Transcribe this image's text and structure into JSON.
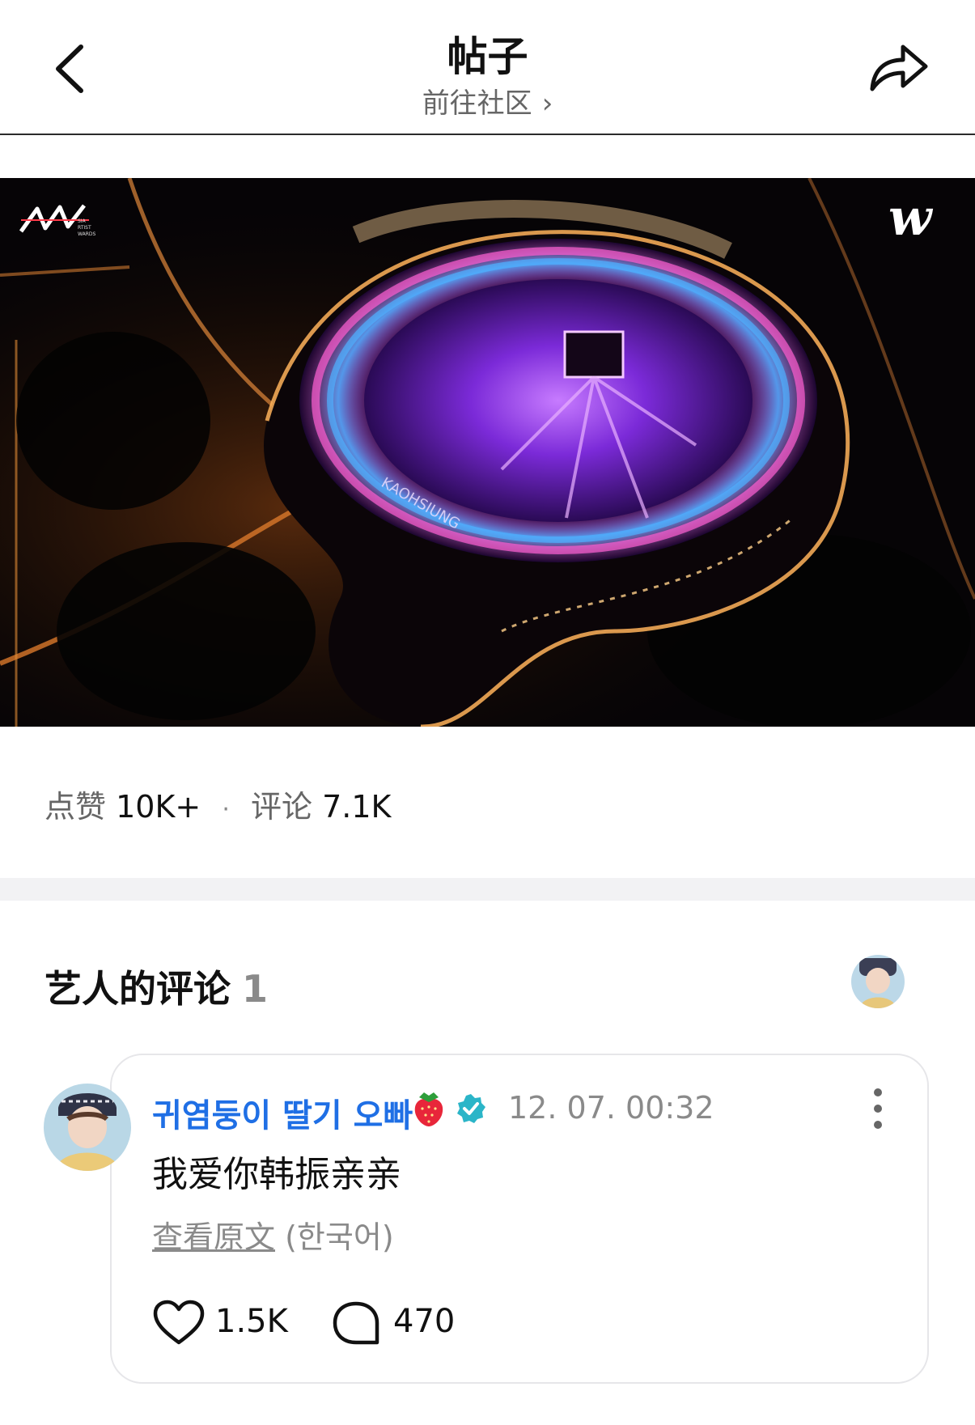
{
  "header": {
    "title": "帖子",
    "community_link": "前往社区",
    "back_icon": "chevron-left-icon",
    "share_icon": "share-arrow-icon"
  },
  "media": {
    "watermark_left": "AAA",
    "watermark_left_sub": [
      "SIA",
      "RTIST",
      "WARDS"
    ],
    "watermark_right": "w",
    "stadium_text": "KAOHSIUNG"
  },
  "stats": {
    "likes_label": "点赞",
    "likes_value": "10K+",
    "separator": "·",
    "comments_label": "评论",
    "comments_value": "7.1K"
  },
  "artist_comments": {
    "title": "艺人的评论",
    "count": "1"
  },
  "comment": {
    "author": "귀염둥이 딸기 오빠",
    "time": "12. 07. 00:32",
    "text": "我爱你韩振亲亲",
    "view_original": "查看原文",
    "original_language": "(한국어)",
    "like_count": "1.5K",
    "reply_count": "470"
  },
  "colors": {
    "author_blue": "#1f6fe5",
    "verified_teal": "#2bb5c8",
    "muted_gray": "#8a8a8a"
  }
}
